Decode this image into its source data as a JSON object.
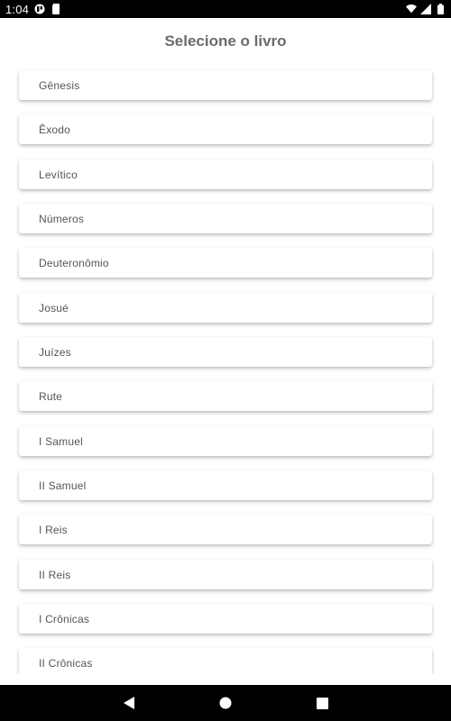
{
  "status_bar": {
    "time": "1:04",
    "icons_left": [
      "notification-app-icon",
      "sim-card-icon"
    ],
    "icons_right": [
      "wifi-icon",
      "cell-signal-icon",
      "battery-icon"
    ]
  },
  "header": {
    "title": "Selecione o livro"
  },
  "books": [
    "Gênesis",
    "Êxodo",
    "Levítico",
    "Números",
    "Deuteronômio",
    "Josué",
    "Juízes",
    "Rute",
    "I Samuel",
    "II Samuel",
    "I Reis",
    "II Reis",
    "I Crônicas",
    "II Crônicas"
  ],
  "nav_bar": {
    "buttons": [
      "back-icon",
      "home-icon",
      "recents-icon"
    ]
  },
  "colors": {
    "status_bar_bg": "#000000",
    "title": "#6b6b6b",
    "item_text": "#555555",
    "background": "#ffffff"
  }
}
